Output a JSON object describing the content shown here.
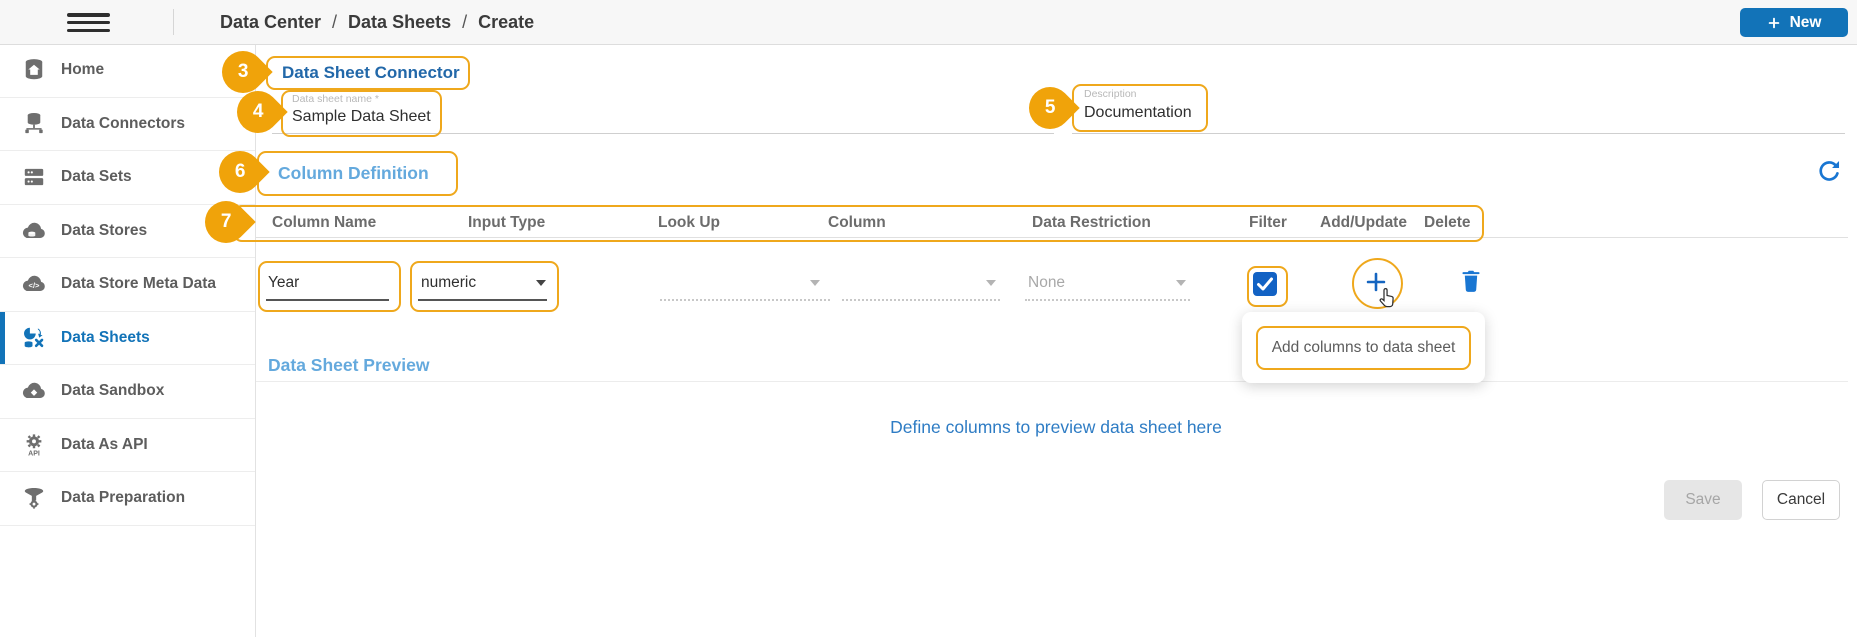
{
  "colors": {
    "accent_orange": "#F0A30A",
    "primary_blue": "#1273B8",
    "section_title_blue": "#2268A9",
    "subsection_blue": "#64A9DD",
    "info_text_blue": "#2E7CC4",
    "checkbox_blue": "#1262C4",
    "action_icon_blue": "#1976D2"
  },
  "topbar": {
    "breadcrumb": [
      "Data Center",
      "Data Sheets",
      "Create"
    ],
    "separator": "/",
    "new_label": "New"
  },
  "sidebar": {
    "items": [
      {
        "label": "Home",
        "icon": "home-database-icon",
        "active": false
      },
      {
        "label": "Data Connectors",
        "icon": "data-connectors-icon",
        "active": false
      },
      {
        "label": "Data Sets",
        "icon": "data-sets-icon",
        "active": false
      },
      {
        "label": "Data Stores",
        "icon": "data-stores-icon",
        "active": false
      },
      {
        "label": "Data Store Meta Data",
        "icon": "data-store-meta-data-icon",
        "active": false
      },
      {
        "label": "Data Sheets",
        "icon": "data-sheets-icon",
        "active": true
      },
      {
        "label": "Data Sandbox",
        "icon": "data-sandbox-icon",
        "active": false
      },
      {
        "label": "Data As API",
        "icon": "data-as-api-icon",
        "active": false
      },
      {
        "label": "Data Preparation",
        "icon": "data-preparation-icon",
        "active": false
      }
    ]
  },
  "form": {
    "section_title": "Data Sheet Connector",
    "name_label": "Data sheet name *",
    "name_value": "Sample Data Sheet",
    "desc_label": "Description",
    "desc_value": "Documentation"
  },
  "columns": {
    "title": "Column Definition",
    "headers": [
      "Column Name",
      "Input Type",
      "Look Up",
      "Column",
      "Data Restriction",
      "Filter",
      "Add/Update",
      "Delete"
    ],
    "row": {
      "column_name": "Year",
      "input_type": "numeric",
      "look_up": "",
      "column": "",
      "data_restriction": "None",
      "filter_checked": true
    }
  },
  "tooltip": {
    "text": "Add columns to data sheet"
  },
  "preview": {
    "title": "Data Sheet Preview",
    "empty_text": "Define columns to preview data sheet here"
  },
  "actions": {
    "save": "Save",
    "cancel": "Cancel"
  },
  "annotations": {
    "badge_3": "3",
    "badge_4": "4",
    "badge_5": "5",
    "badge_6": "6",
    "badge_7": "7"
  }
}
